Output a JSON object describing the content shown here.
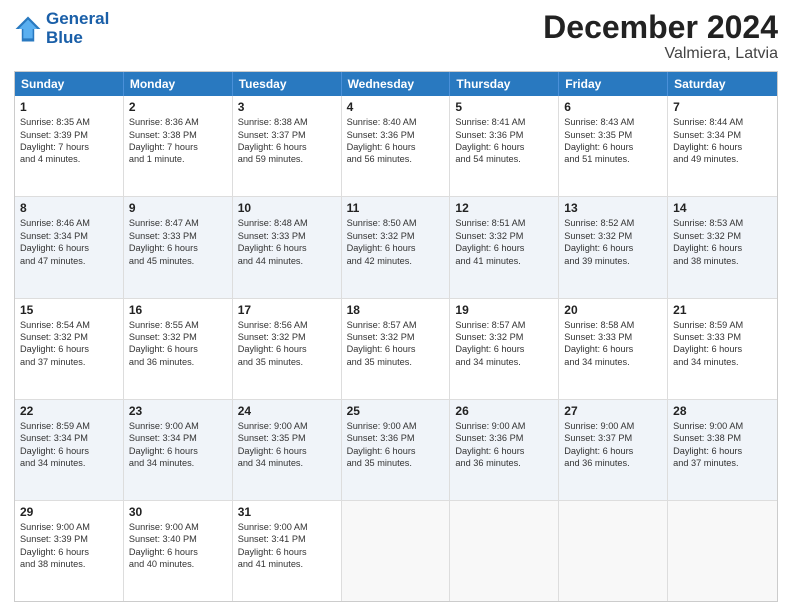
{
  "logo": {
    "line1": "General",
    "line2": "Blue"
  },
  "title": "December 2024",
  "subtitle": "Valmiera, Latvia",
  "days": [
    "Sunday",
    "Monday",
    "Tuesday",
    "Wednesday",
    "Thursday",
    "Friday",
    "Saturday"
  ],
  "rows": [
    [
      {
        "day": "1",
        "lines": [
          "Sunrise: 8:35 AM",
          "Sunset: 3:39 PM",
          "Daylight: 7 hours",
          "and 4 minutes."
        ]
      },
      {
        "day": "2",
        "lines": [
          "Sunrise: 8:36 AM",
          "Sunset: 3:38 PM",
          "Daylight: 7 hours",
          "and 1 minute."
        ]
      },
      {
        "day": "3",
        "lines": [
          "Sunrise: 8:38 AM",
          "Sunset: 3:37 PM",
          "Daylight: 6 hours",
          "and 59 minutes."
        ]
      },
      {
        "day": "4",
        "lines": [
          "Sunrise: 8:40 AM",
          "Sunset: 3:36 PM",
          "Daylight: 6 hours",
          "and 56 minutes."
        ]
      },
      {
        "day": "5",
        "lines": [
          "Sunrise: 8:41 AM",
          "Sunset: 3:36 PM",
          "Daylight: 6 hours",
          "and 54 minutes."
        ]
      },
      {
        "day": "6",
        "lines": [
          "Sunrise: 8:43 AM",
          "Sunset: 3:35 PM",
          "Daylight: 6 hours",
          "and 51 minutes."
        ]
      },
      {
        "day": "7",
        "lines": [
          "Sunrise: 8:44 AM",
          "Sunset: 3:34 PM",
          "Daylight: 6 hours",
          "and 49 minutes."
        ]
      }
    ],
    [
      {
        "day": "8",
        "lines": [
          "Sunrise: 8:46 AM",
          "Sunset: 3:34 PM",
          "Daylight: 6 hours",
          "and 47 minutes."
        ]
      },
      {
        "day": "9",
        "lines": [
          "Sunrise: 8:47 AM",
          "Sunset: 3:33 PM",
          "Daylight: 6 hours",
          "and 45 minutes."
        ]
      },
      {
        "day": "10",
        "lines": [
          "Sunrise: 8:48 AM",
          "Sunset: 3:33 PM",
          "Daylight: 6 hours",
          "and 44 minutes."
        ]
      },
      {
        "day": "11",
        "lines": [
          "Sunrise: 8:50 AM",
          "Sunset: 3:32 PM",
          "Daylight: 6 hours",
          "and 42 minutes."
        ]
      },
      {
        "day": "12",
        "lines": [
          "Sunrise: 8:51 AM",
          "Sunset: 3:32 PM",
          "Daylight: 6 hours",
          "and 41 minutes."
        ]
      },
      {
        "day": "13",
        "lines": [
          "Sunrise: 8:52 AM",
          "Sunset: 3:32 PM",
          "Daylight: 6 hours",
          "and 39 minutes."
        ]
      },
      {
        "day": "14",
        "lines": [
          "Sunrise: 8:53 AM",
          "Sunset: 3:32 PM",
          "Daylight: 6 hours",
          "and 38 minutes."
        ]
      }
    ],
    [
      {
        "day": "15",
        "lines": [
          "Sunrise: 8:54 AM",
          "Sunset: 3:32 PM",
          "Daylight: 6 hours",
          "and 37 minutes."
        ]
      },
      {
        "day": "16",
        "lines": [
          "Sunrise: 8:55 AM",
          "Sunset: 3:32 PM",
          "Daylight: 6 hours",
          "and 36 minutes."
        ]
      },
      {
        "day": "17",
        "lines": [
          "Sunrise: 8:56 AM",
          "Sunset: 3:32 PM",
          "Daylight: 6 hours",
          "and 35 minutes."
        ]
      },
      {
        "day": "18",
        "lines": [
          "Sunrise: 8:57 AM",
          "Sunset: 3:32 PM",
          "Daylight: 6 hours",
          "and 35 minutes."
        ]
      },
      {
        "day": "19",
        "lines": [
          "Sunrise: 8:57 AM",
          "Sunset: 3:32 PM",
          "Daylight: 6 hours",
          "and 34 minutes."
        ]
      },
      {
        "day": "20",
        "lines": [
          "Sunrise: 8:58 AM",
          "Sunset: 3:33 PM",
          "Daylight: 6 hours",
          "and 34 minutes."
        ]
      },
      {
        "day": "21",
        "lines": [
          "Sunrise: 8:59 AM",
          "Sunset: 3:33 PM",
          "Daylight: 6 hours",
          "and 34 minutes."
        ]
      }
    ],
    [
      {
        "day": "22",
        "lines": [
          "Sunrise: 8:59 AM",
          "Sunset: 3:34 PM",
          "Daylight: 6 hours",
          "and 34 minutes."
        ]
      },
      {
        "day": "23",
        "lines": [
          "Sunrise: 9:00 AM",
          "Sunset: 3:34 PM",
          "Daylight: 6 hours",
          "and 34 minutes."
        ]
      },
      {
        "day": "24",
        "lines": [
          "Sunrise: 9:00 AM",
          "Sunset: 3:35 PM",
          "Daylight: 6 hours",
          "and 34 minutes."
        ]
      },
      {
        "day": "25",
        "lines": [
          "Sunrise: 9:00 AM",
          "Sunset: 3:36 PM",
          "Daylight: 6 hours",
          "and 35 minutes."
        ]
      },
      {
        "day": "26",
        "lines": [
          "Sunrise: 9:00 AM",
          "Sunset: 3:36 PM",
          "Daylight: 6 hours",
          "and 36 minutes."
        ]
      },
      {
        "day": "27",
        "lines": [
          "Sunrise: 9:00 AM",
          "Sunset: 3:37 PM",
          "Daylight: 6 hours",
          "and 36 minutes."
        ]
      },
      {
        "day": "28",
        "lines": [
          "Sunrise: 9:00 AM",
          "Sunset: 3:38 PM",
          "Daylight: 6 hours",
          "and 37 minutes."
        ]
      }
    ],
    [
      {
        "day": "29",
        "lines": [
          "Sunrise: 9:00 AM",
          "Sunset: 3:39 PM",
          "Daylight: 6 hours",
          "and 38 minutes."
        ]
      },
      {
        "day": "30",
        "lines": [
          "Sunrise: 9:00 AM",
          "Sunset: 3:40 PM",
          "Daylight: 6 hours",
          "and 40 minutes."
        ]
      },
      {
        "day": "31",
        "lines": [
          "Sunrise: 9:00 AM",
          "Sunset: 3:41 PM",
          "Daylight: 6 hours",
          "and 41 minutes."
        ]
      },
      {
        "day": "",
        "lines": []
      },
      {
        "day": "",
        "lines": []
      },
      {
        "day": "",
        "lines": []
      },
      {
        "day": "",
        "lines": []
      }
    ]
  ]
}
